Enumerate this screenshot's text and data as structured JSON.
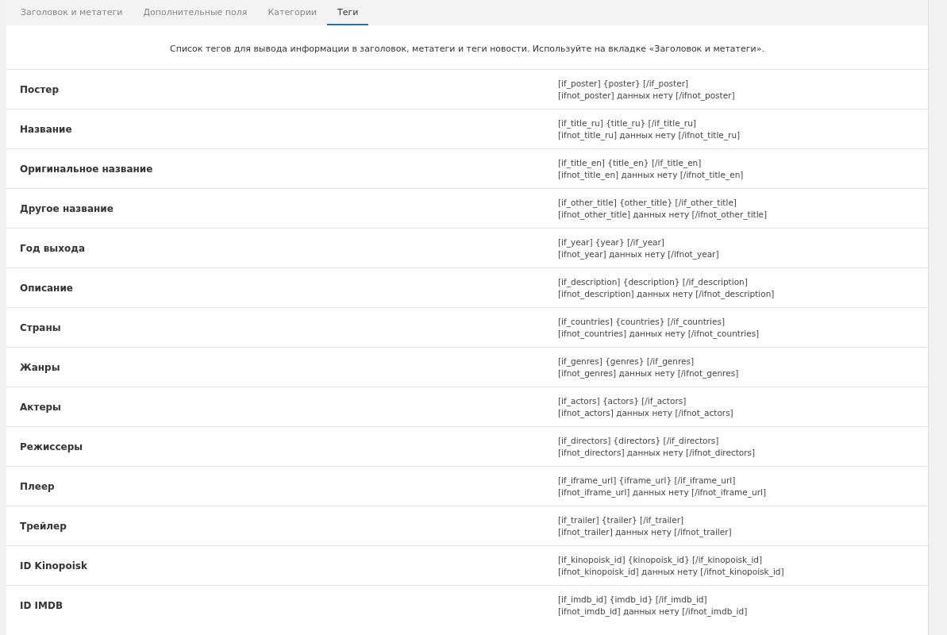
{
  "tabs": [
    {
      "label": "Заголовок и метатеги",
      "selected": false
    },
    {
      "label": "Дополнительные поля",
      "selected": false
    },
    {
      "label": "Категории",
      "selected": false
    },
    {
      "label": "Теги",
      "selected": true
    }
  ],
  "description": "Список тегов для вывода информации в заголовок, метатеги и теги новости. Используйте на вкладке «Заголовок и метатеги».",
  "rows": [
    {
      "name": "Постер",
      "tag": "[if_poster] {poster} [/if_poster]",
      "fallback": "[ifnot_poster] данных нету [/ifnot_poster]"
    },
    {
      "name": "Название",
      "tag": "[if_title_ru] {title_ru} [/if_title_ru]",
      "fallback": "[ifnot_title_ru] данных нету [/ifnot_title_ru]"
    },
    {
      "name": "Оригинальное название",
      "tag": "[if_title_en] {title_en} [/if_title_en]",
      "fallback": "[ifnot_title_en] данных нету [/ifnot_title_en]"
    },
    {
      "name": "Другое название",
      "tag": "[if_other_title] {other_title} [/if_other_title]",
      "fallback": "[ifnot_other_title] данных нету [/ifnot_other_title]"
    },
    {
      "name": "Год выхода",
      "tag": "[if_year] {year} [/if_year]",
      "fallback": "[ifnot_year] данных нету [/ifnot_year]"
    },
    {
      "name": "Описание",
      "tag": "[if_description] {description} [/if_description]",
      "fallback": "[ifnot_description] данных нету [/ifnot_description]"
    },
    {
      "name": "Страны",
      "tag": "[if_countries] {countries} [/if_countries]",
      "fallback": "[ifnot_countries] данных нету [/ifnot_countries]"
    },
    {
      "name": "Жанры",
      "tag": "[if_genres] {genres} [/if_genres]",
      "fallback": "[ifnot_genres] данных нету [/ifnot_genres]"
    },
    {
      "name": "Актеры",
      "tag": "[if_actors] {actors} [/if_actors]",
      "fallback": "[ifnot_actors] данных нету [/ifnot_actors]"
    },
    {
      "name": "Режиссеры",
      "tag": "[if_directors] {directors} [/if_directors]",
      "fallback": "[ifnot_directors] данных нету [/ifnot_directors]"
    },
    {
      "name": "Плеер",
      "tag": "[if_iframe_url] {iframe_url} [/if_iframe_url]",
      "fallback": "[ifnot_iframe_url] данных нету [/ifnot_iframe_url]"
    },
    {
      "name": "Трейлер",
      "tag": "[if_trailer] {trailer} [/if_trailer]",
      "fallback": "[ifnot_trailer] данных нету [/ifnot_trailer]"
    },
    {
      "name": "ID Kinopoisk",
      "tag": "[if_kinopoisk_id] {kinopoisk_id} [/if_kinopoisk_id]",
      "fallback": "[ifnot_kinopoisk_id] данных нету [/ifnot_kinopoisk_id]"
    },
    {
      "name": "ID IMDB",
      "tag": "[if_imdb_id] {imdb_id} [/if_imdb_id]",
      "fallback": "[ifnot_imdb_id] данных нету [/ifnot_imdb_id]"
    }
  ]
}
